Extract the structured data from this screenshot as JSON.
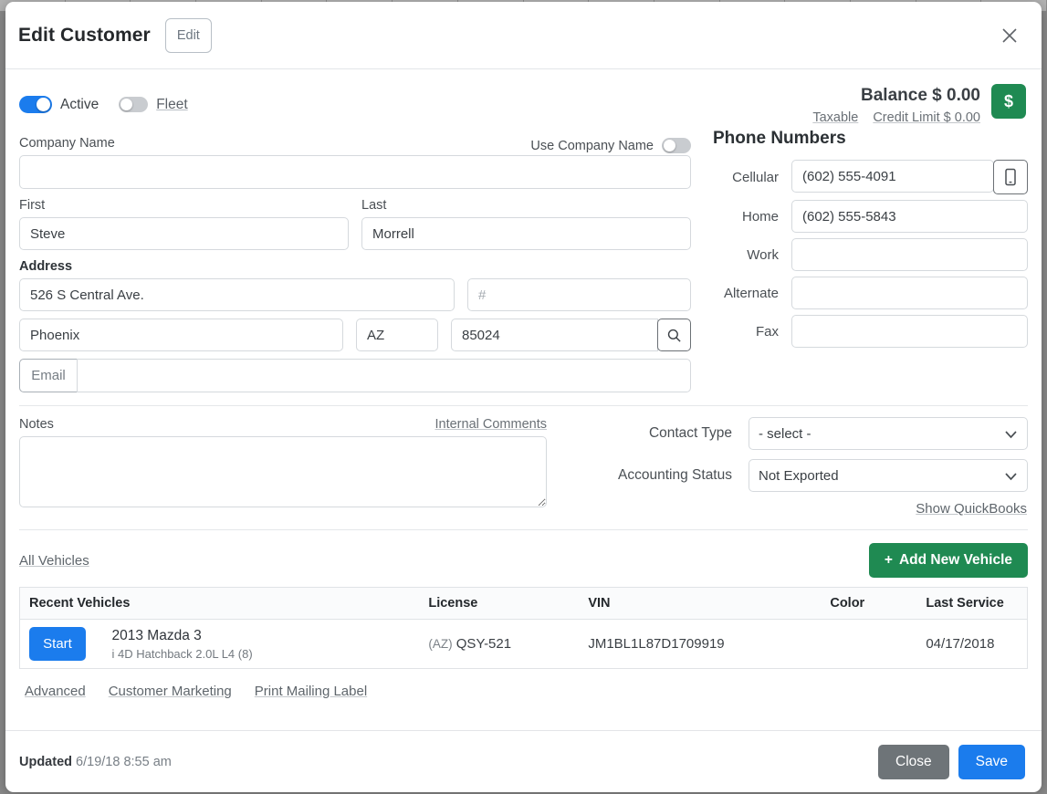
{
  "header": {
    "title": "Edit Customer",
    "edit_label": "Edit",
    "close_icon": "close-icon"
  },
  "status": {
    "active_label": "Active",
    "active_on": true,
    "fleet_label": "Fleet",
    "fleet_on": false
  },
  "balance": {
    "main": "Balance $ 0.00",
    "taxable_label": "Taxable",
    "credit_limit_label": "Credit Limit $ 0.00",
    "badge_glyph": "$"
  },
  "customer": {
    "company_name_label": "Company Name",
    "company_name_value": "",
    "use_company_name_label": "Use Company Name",
    "use_company_name_on": false,
    "first_label": "First",
    "first_value": "Steve",
    "last_label": "Last",
    "last_value": "Morrell",
    "address_label": "Address",
    "street_value": "526 S Central Ave.",
    "unit_placeholder": "#",
    "unit_value": "",
    "city_value": "Phoenix",
    "state_value": "AZ",
    "zip_value": "85024",
    "zip_search_icon": "search-icon",
    "email_button_label": "Email",
    "email_value": ""
  },
  "phones": {
    "title": "Phone Numbers",
    "rows": [
      {
        "label": "Cellular",
        "value": "(602) 555-4091",
        "has_button": true,
        "button_icon": "mobile-phone-icon"
      },
      {
        "label": "Home",
        "value": "(602) 555-5843",
        "has_button": false
      },
      {
        "label": "Work",
        "value": "",
        "has_button": false
      },
      {
        "label": "Alternate",
        "value": "",
        "has_button": false
      },
      {
        "label": "Fax",
        "value": "",
        "has_button": false
      }
    ]
  },
  "notes": {
    "label": "Notes",
    "internal_comments_label": "Internal Comments",
    "value": ""
  },
  "selects": {
    "contact_type_label": "Contact Type",
    "contact_type_value": "- select -",
    "contact_type_options": [
      "- select -"
    ],
    "accounting_status_label": "Accounting Status",
    "accounting_status_value": "Not Exported",
    "accounting_status_options": [
      "Not Exported"
    ],
    "show_quickbooks_label": "Show QuickBooks"
  },
  "vehicles": {
    "all_vehicles_label": "All Vehicles",
    "add_new_label": "Add New Vehicle",
    "add_new_plus": "+",
    "columns": [
      "Recent Vehicles",
      "License",
      "VIN",
      "Color",
      "Last Service"
    ],
    "rows": [
      {
        "start_label": "Start",
        "name": "2013 Mazda 3",
        "trim": "i 4D Hatchback 2.0L L4 (8)",
        "license_state": "(AZ)",
        "license_plate": "QSY-521",
        "vin": "JM1BL1L87D1709919",
        "color": "",
        "last_service": "04/17/2018"
      }
    ]
  },
  "bottom_links": [
    "Advanced",
    "Customer Marketing",
    "Print Mailing Label"
  ],
  "footer": {
    "updated_prefix": "Updated",
    "updated_value": "6/19/18 8:55 am",
    "close_label": "Close",
    "save_label": "Save"
  }
}
